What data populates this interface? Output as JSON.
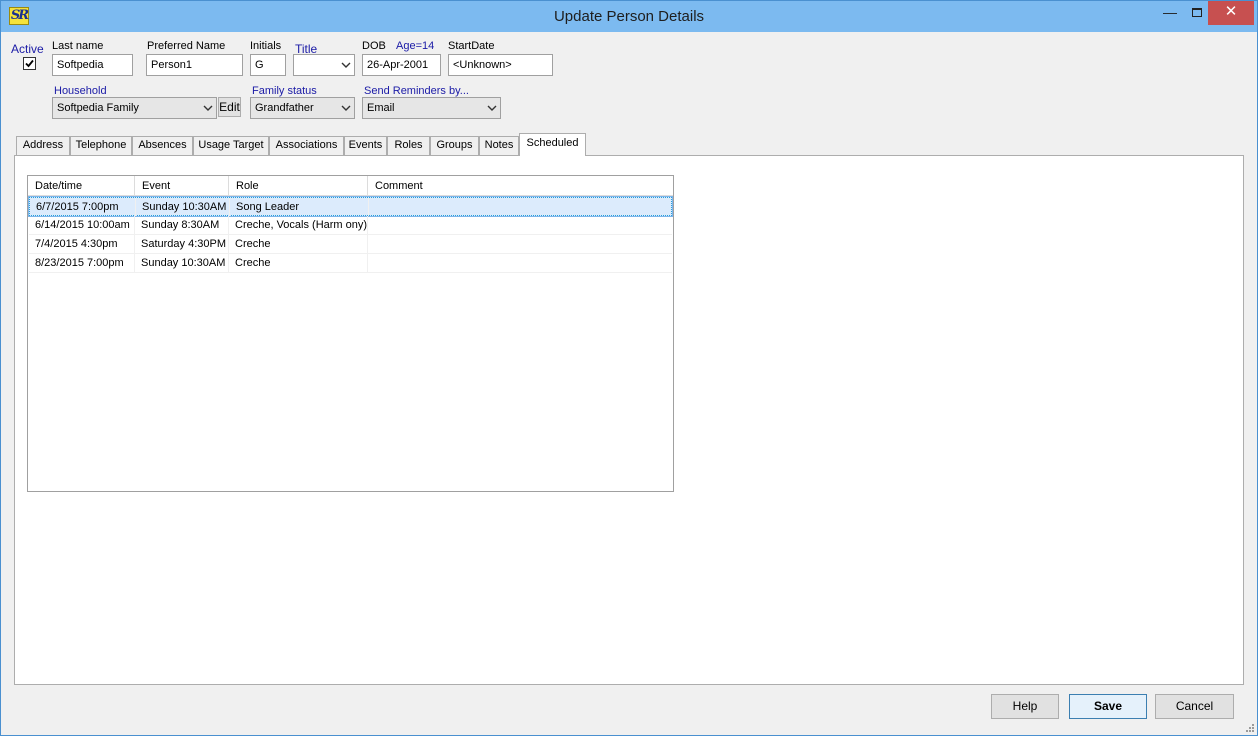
{
  "window": {
    "title": "Update Person Details",
    "icon_text": "SR",
    "controls": {
      "minimize": "—",
      "maximize": "",
      "close": "✕"
    }
  },
  "form": {
    "active_label": "Active",
    "active_checked": true,
    "last_name_label": "Last name",
    "last_name_value": "Softpedia",
    "preferred_name_label": "Preferred Name",
    "preferred_name_value": "Person1",
    "initials_label": "Initials",
    "initials_value": "G",
    "title_label": "Title",
    "title_value": "",
    "dob_label": "DOB",
    "age_label": "Age=14",
    "dob_value": "26-Apr-2001",
    "start_date_label": "StartDate",
    "start_date_value": "<Unknown>",
    "household_label": "Household",
    "household_value": "Softpedia Family",
    "edit_label": "Edit",
    "family_status_label": "Family status",
    "family_status_value": "Grandfather",
    "reminders_label": "Send Reminders by...",
    "reminders_value": "Email"
  },
  "tabs": [
    {
      "label": "Address"
    },
    {
      "label": "Telephone"
    },
    {
      "label": "Absences"
    },
    {
      "label": "Usage Target"
    },
    {
      "label": "Associations"
    },
    {
      "label": "Events"
    },
    {
      "label": "Roles"
    },
    {
      "label": "Groups"
    },
    {
      "label": "Notes"
    },
    {
      "label": "Scheduled",
      "active": true
    }
  ],
  "scheduled": {
    "columns": [
      "Date/time",
      "Event",
      "Role",
      "Comment"
    ],
    "rows": [
      {
        "datetime": "6/7/2015 7:00pm",
        "event": "Sunday 10:30AM",
        "role": "Song Leader",
        "comment": "",
        "selected": true
      },
      {
        "datetime": "6/14/2015 10:00am",
        "event": "Sunday 8:30AM",
        "role": "Creche, Vocals (Harm ony)",
        "comment": ""
      },
      {
        "datetime": "7/4/2015 4:30pm",
        "event": "Saturday 4:30PM",
        "role": "Creche",
        "comment": ""
      },
      {
        "datetime": "8/23/2015 7:00pm",
        "event": "Sunday 10:30AM",
        "role": "Creche",
        "comment": ""
      }
    ]
  },
  "buttons": {
    "help": "Help",
    "save": "Save",
    "cancel": "Cancel"
  },
  "colors": {
    "titlebar": "#7cbaf0",
    "close_button": "#c75050",
    "label_blue": "#1a1aa6",
    "selection": "#dcebfc"
  }
}
